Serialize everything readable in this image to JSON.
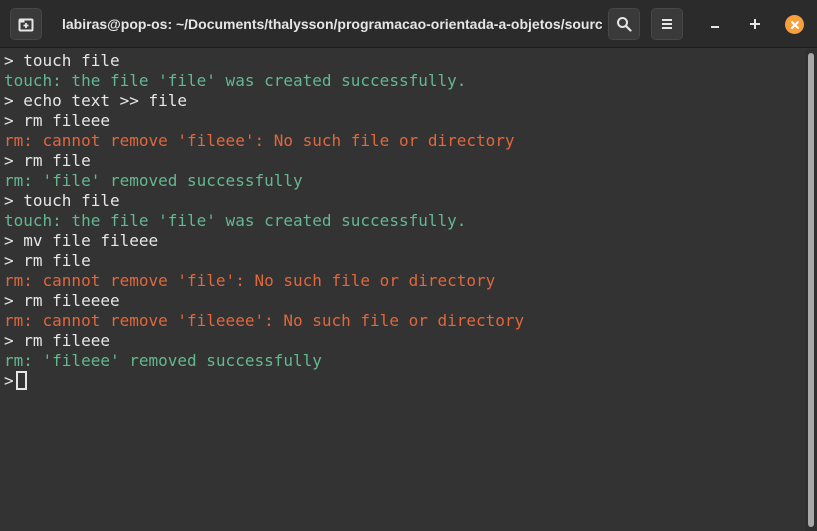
{
  "titlebar": {
    "title": "labiras@pop-os: ~/Documents/thalysson/programacao-orientada-a-objetos/source-…",
    "new_tab_icon": "new-tab-icon",
    "search_icon": "search-icon",
    "menu_icon": "hamburger-menu-icon",
    "minimize_label": "–",
    "maximize_label": "+",
    "close_icon": "close-icon",
    "close_color": "#f6a03d"
  },
  "terminal": {
    "colors": {
      "fg": "#e6e6e6",
      "success": "#63b88f",
      "error": "#e1673c",
      "bg": "#333333"
    },
    "lines": [
      {
        "type": "prompt",
        "text": "> touch file"
      },
      {
        "type": "success",
        "text": "touch: the file 'file' was created successfully."
      },
      {
        "type": "prompt",
        "text": "> echo text >> file"
      },
      {
        "type": "prompt",
        "text": "> rm fileee"
      },
      {
        "type": "error",
        "text": "rm: cannot remove 'fileee': No such file or directory"
      },
      {
        "type": "prompt",
        "text": "> rm file"
      },
      {
        "type": "success",
        "text": "rm: 'file' removed successfully"
      },
      {
        "type": "prompt",
        "text": "> touch file"
      },
      {
        "type": "success",
        "text": "touch: the file 'file' was created successfully."
      },
      {
        "type": "prompt",
        "text": "> mv file fileee"
      },
      {
        "type": "prompt",
        "text": "> rm file"
      },
      {
        "type": "error",
        "text": "rm: cannot remove 'file': No such file or directory"
      },
      {
        "type": "prompt",
        "text": "> rm fileeee"
      },
      {
        "type": "error",
        "text": "rm: cannot remove 'fileeee': No such file or directory"
      },
      {
        "type": "prompt",
        "text": "> rm fileee"
      },
      {
        "type": "success",
        "text": "rm: 'fileee' removed successfully"
      }
    ],
    "current_prompt": ">"
  }
}
